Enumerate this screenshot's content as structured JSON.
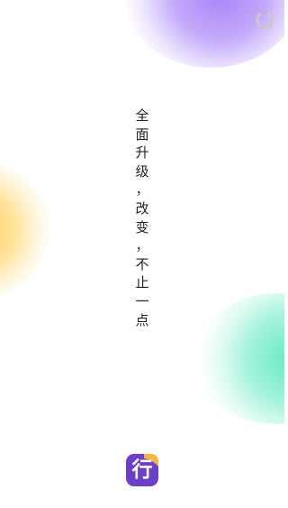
{
  "splash": {
    "tagline_chars": [
      "全",
      "面",
      "升",
      "级",
      "，",
      "改",
      "变",
      "，",
      "不",
      "止",
      "一",
      "点"
    ],
    "logo_char": "行"
  },
  "icons": {
    "loading": "loading-spinner-icon",
    "logo": "app-logo-icon"
  },
  "colors": {
    "background": "#ffffff",
    "tagline_text": "#222222",
    "logo_tile": "#6b3fc8",
    "logo_accent": "#f4b63f",
    "blob_purple": "#a37bf5",
    "blob_yellow": "#fccf54",
    "blob_green": "#5fe8be",
    "spinner": "#c9c9c9"
  }
}
